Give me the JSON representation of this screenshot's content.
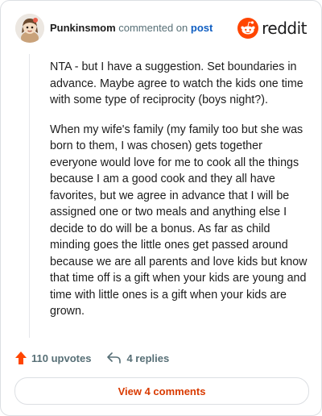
{
  "header": {
    "author": "Punkinsmom",
    "action_text": "commented on",
    "post_link": "post",
    "brand_name": "reddit",
    "brand_icon": "reddit-snoo-icon",
    "avatar_icon": "user-avatar"
  },
  "comment": {
    "paragraphs": [
      "NTA - but I have a suggestion. Set boundaries in advance. Maybe agree to watch the kids one time with some type of reciprocity (boys night?).",
      "When my wife's family (my family too but she was born to them, I was chosen) gets together everyone would love for me to cook all the things because I am a good cook and they all have favorites, but we agree in advance that I will be assigned one or two meals and anything else I decide to do will be a bonus. As far as child minding goes the little ones get passed around because we are all parents and love kids but know that time off is a gift when your kids are young and time with little ones is a gift when your kids are grown."
    ]
  },
  "actions": {
    "upvotes_label": "110 upvotes",
    "replies_label": "4 replies",
    "upvote_icon": "upvote-arrow-icon",
    "reply_icon": "reply-arrow-icon"
  },
  "view_button": {
    "label": "View 4 comments"
  },
  "colors": {
    "accent": "#ff4500",
    "link": "#0f5ec2",
    "button_text": "#d93a00",
    "muted": "#576f76"
  }
}
